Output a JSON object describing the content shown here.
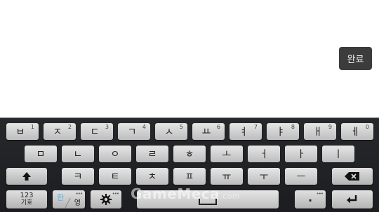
{
  "editor": {
    "done_label": "완료"
  },
  "keyboard": {
    "row1": [
      {
        "main": "ㅂ",
        "hint": "1"
      },
      {
        "main": "ㅈ",
        "hint": "2"
      },
      {
        "main": "ㄷ",
        "hint": "3"
      },
      {
        "main": "ㄱ",
        "hint": "4"
      },
      {
        "main": "ㅅ",
        "hint": "5"
      },
      {
        "main": "ㅛ",
        "hint": "6"
      },
      {
        "main": "ㅕ",
        "hint": "7"
      },
      {
        "main": "ㅑ",
        "hint": "8"
      },
      {
        "main": "ㅐ",
        "hint": "9"
      },
      {
        "main": "ㅔ",
        "hint": "0"
      }
    ],
    "row2": [
      "ㅁ",
      "ㄴ",
      "ㅇ",
      "ㄹ",
      "ㅎ",
      "ㅗ",
      "ㅓ",
      "ㅏ",
      "ㅣ"
    ],
    "row3": [
      "ㅋ",
      "ㅌ",
      "ㅊ",
      "ㅍ",
      "ㅠ",
      "ㅜ",
      "ㅡ"
    ],
    "symbols_key": {
      "top": "123",
      "bottom": "기호"
    },
    "lang_key": {
      "korean": "한",
      "english": "영"
    },
    "period_key": "."
  },
  "watermark": {
    "text": "GameMeca",
    "suffix": ".com"
  },
  "colors": {
    "keyboard_bg": "#1e2023",
    "key_face": "#d4d4d4",
    "done_bg": "#3c3c3c",
    "lang_accent": "#5ab4e8"
  }
}
